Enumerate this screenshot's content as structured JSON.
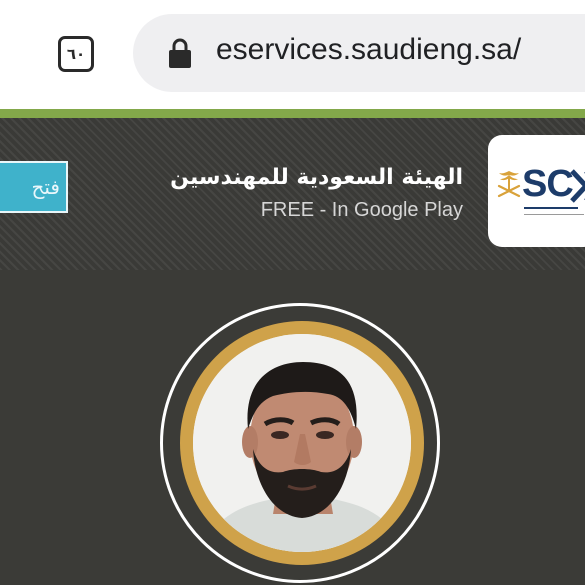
{
  "browser": {
    "tab_count": "٦٠",
    "url": "eservices.saudieng.sa/"
  },
  "banner": {
    "open_label": "فتح",
    "app_name": "الهيئة السعودية للمهندسين",
    "app_subtitle": "FREE - In Google Play",
    "logo_letters": "SC"
  },
  "icons": {
    "lock": "lock-icon",
    "palm": "palm-swords-icon"
  },
  "colors": {
    "accent_green": "#83a84a",
    "open_button": "#3fb2cb",
    "gold_ring": "#cfa24a",
    "background": "#3b3b37"
  }
}
